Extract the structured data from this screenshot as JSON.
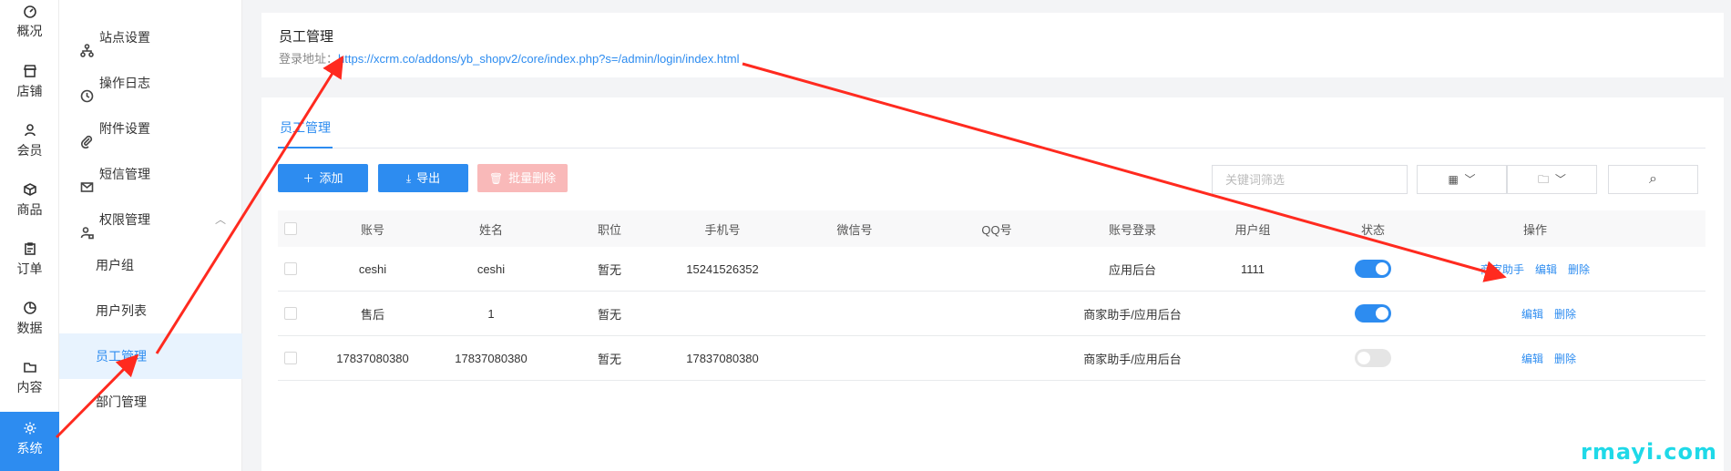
{
  "rail": {
    "items": [
      {
        "label": "概况",
        "icon": "dashboard-icon"
      },
      {
        "label": "店铺",
        "icon": "store-icon"
      },
      {
        "label": "会员",
        "icon": "user-icon"
      },
      {
        "label": "商品",
        "icon": "box-icon"
      },
      {
        "label": "订单",
        "icon": "clipboard-icon"
      },
      {
        "label": "数据",
        "icon": "chart-icon"
      },
      {
        "label": "内容",
        "icon": "folder-icon"
      },
      {
        "label": "系统",
        "icon": "gear-icon"
      }
    ],
    "active": "系统"
  },
  "menu": {
    "top_fragment": "",
    "items": [
      {
        "label": "站点设置",
        "icon": "sitemap-icon"
      },
      {
        "label": "操作日志",
        "icon": "history-icon"
      },
      {
        "label": "附件设置",
        "icon": "paperclip-icon"
      },
      {
        "label": "短信管理",
        "icon": "mail-icon"
      },
      {
        "label": "权限管理",
        "icon": "user-lock-icon"
      },
      {
        "label": "用户组"
      },
      {
        "label": "用户列表"
      },
      {
        "label": "员工管理"
      },
      {
        "label": "部门管理"
      }
    ],
    "active": "员工管理"
  },
  "info": {
    "title": "员工管理",
    "login_label": "登录地址：",
    "login_url": "https://xcrm.co/addons/yb_shopv2/core/index.php?s=/admin/login/index.html"
  },
  "main": {
    "tab": "员工管理",
    "buttons": {
      "add": "添加",
      "export": "导出",
      "bulk_delete": "批量删除"
    },
    "search_placeholder": "关键词筛选",
    "table": {
      "headers": [
        "账号",
        "姓名",
        "职位",
        "手机号",
        "微信号",
        "QQ号",
        "账号登录",
        "用户组",
        "状态",
        "操作"
      ],
      "rows": [
        {
          "account": "ceshi",
          "name": "ceshi",
          "position": "暂无",
          "phone": "15241526352",
          "wechat": "",
          "qq": "",
          "login": "应用后台",
          "group": "1111",
          "status": true,
          "ops": [
            "商家助手",
            "编辑",
            "删除"
          ]
        },
        {
          "account": "售后",
          "name": "1",
          "position": "暂无",
          "phone": "",
          "wechat": "",
          "qq": "",
          "login": "商家助手/应用后台",
          "group": "",
          "status": true,
          "ops": [
            "编辑",
            "删除"
          ]
        },
        {
          "account": "17837080380",
          "name": "17837080380",
          "position": "暂无",
          "phone": "17837080380",
          "wechat": "",
          "qq": "",
          "login": "商家助手/应用后台",
          "group": "",
          "status": false,
          "ops": [
            "编辑",
            "删除"
          ]
        }
      ]
    }
  },
  "colors": {
    "accent": "#2d8cf0",
    "danger_light": "#f9b9b9",
    "arrow": "#ff2a1f",
    "watermark": "#1fd9e8"
  },
  "watermark": "rmayi.com"
}
